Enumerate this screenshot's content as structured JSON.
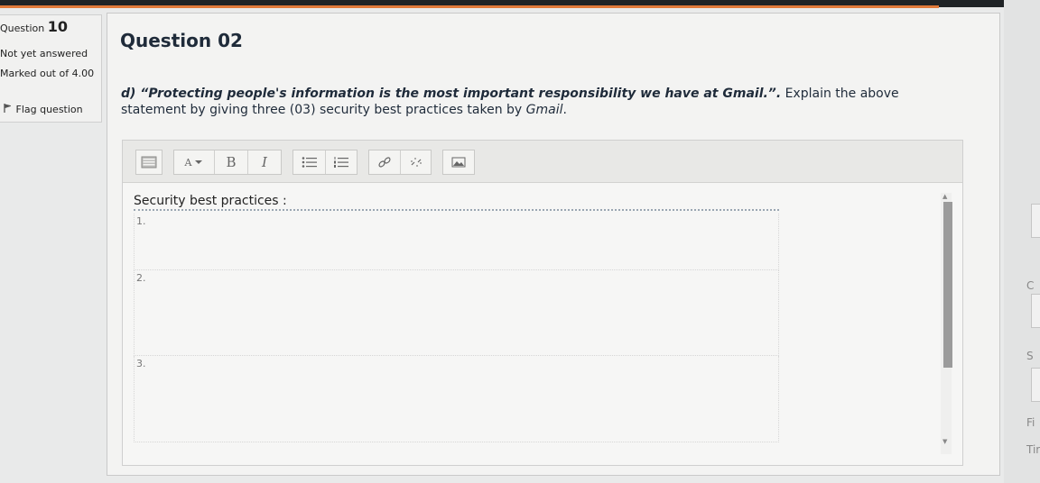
{
  "quiz_info": {
    "question_label": "Question",
    "question_number": "10",
    "status": "Not yet answered",
    "marked_out_of": "Marked out of 4.00",
    "flag_label": "Flag question"
  },
  "question": {
    "title": "Question 02",
    "prefix": "d) ",
    "quote": "“Protecting people's information is the most important responsibility we have at Gmail.”.",
    "instruction": " Explain the above statement by giving three (03) security best practices taken by ",
    "gmail": "Gmail",
    "end": "."
  },
  "editor": {
    "toolbar_icons": [
      "toolbar-toggle-icon",
      "font-color-icon",
      "bold-icon",
      "italic-icon",
      "unordered-list-icon",
      "ordered-list-icon",
      "link-icon",
      "unlink-icon",
      "image-icon"
    ],
    "font_color_symbol": "A",
    "bold_symbol": "B",
    "italic_symbol": "I",
    "heading": "Security best practices :",
    "lines": [
      "1.",
      "2.",
      "3."
    ]
  },
  "right_edge_text": [
    "C",
    "S",
    "Fi",
    "Tir"
  ],
  "colors": {
    "accent": "#e07a3a",
    "question_text": "#1f2b3a",
    "background": "#e9eaea"
  }
}
